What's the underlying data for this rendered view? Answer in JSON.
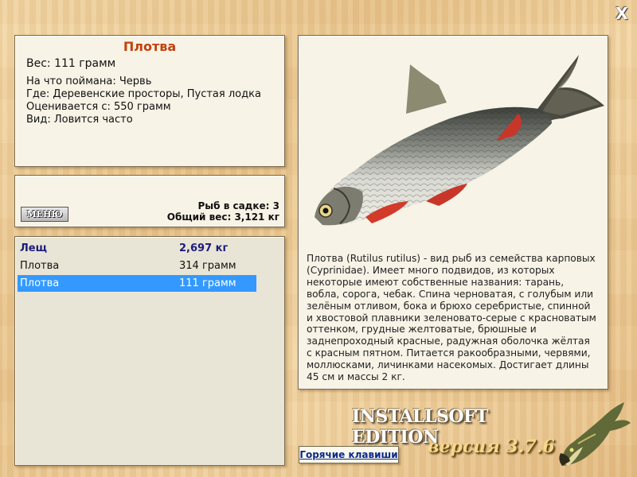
{
  "close": "X",
  "info": {
    "title": "Плотва",
    "weight": "Вес: 111 грамм",
    "lines": [
      "На что поймана: Червь",
      "Где: Деревенские просторы, Пустая лодка",
      "Оценивается с: 550 грамм",
      "Вид: Ловится часто"
    ]
  },
  "summary": {
    "menu_label": "МЕНЮ",
    "fish_in_net": "Рыб в садке: 3",
    "total_weight": "Общий вес: 3,121 кг"
  },
  "catch_list": [
    {
      "name": "Лещ",
      "weight": "2,697 кг",
      "style": "head"
    },
    {
      "name": "Плотва",
      "weight": "314 грамм",
      "style": "normal"
    },
    {
      "name": "Плотва",
      "weight": "111 грамм",
      "style": "selected"
    }
  ],
  "fish": {
    "description": "Плотва (Rutilus rutilus) - вид рыб из семейства карповых (Cyprinidae). Имеет много подвидов, из которых некоторые имеют собственные названия: тарань, вобла, сорога, чебак. Спина черноватая, с голубым или зелёным отливом, бока и брюхо серебристые, спинной и хвостовой плавники зеленовато-серые с красноватым оттенком, грудные желтоватые, брюшные и заднепроходный красные, радужная оболочка жёлтая с красным пятном. Питается ракообразными, червями, моллюсками, личинками насекомых. Достигает длины 45 см и массы 2 кг."
  },
  "brand": {
    "edition": "INSTALLSOFT EDITION",
    "version": "версия 3.7.6"
  },
  "hotkeys_label": "Горячие клавиши",
  "colors": {
    "title": "#c2410c",
    "selected_row": "#3399ff",
    "link": "#0a2a8a"
  }
}
